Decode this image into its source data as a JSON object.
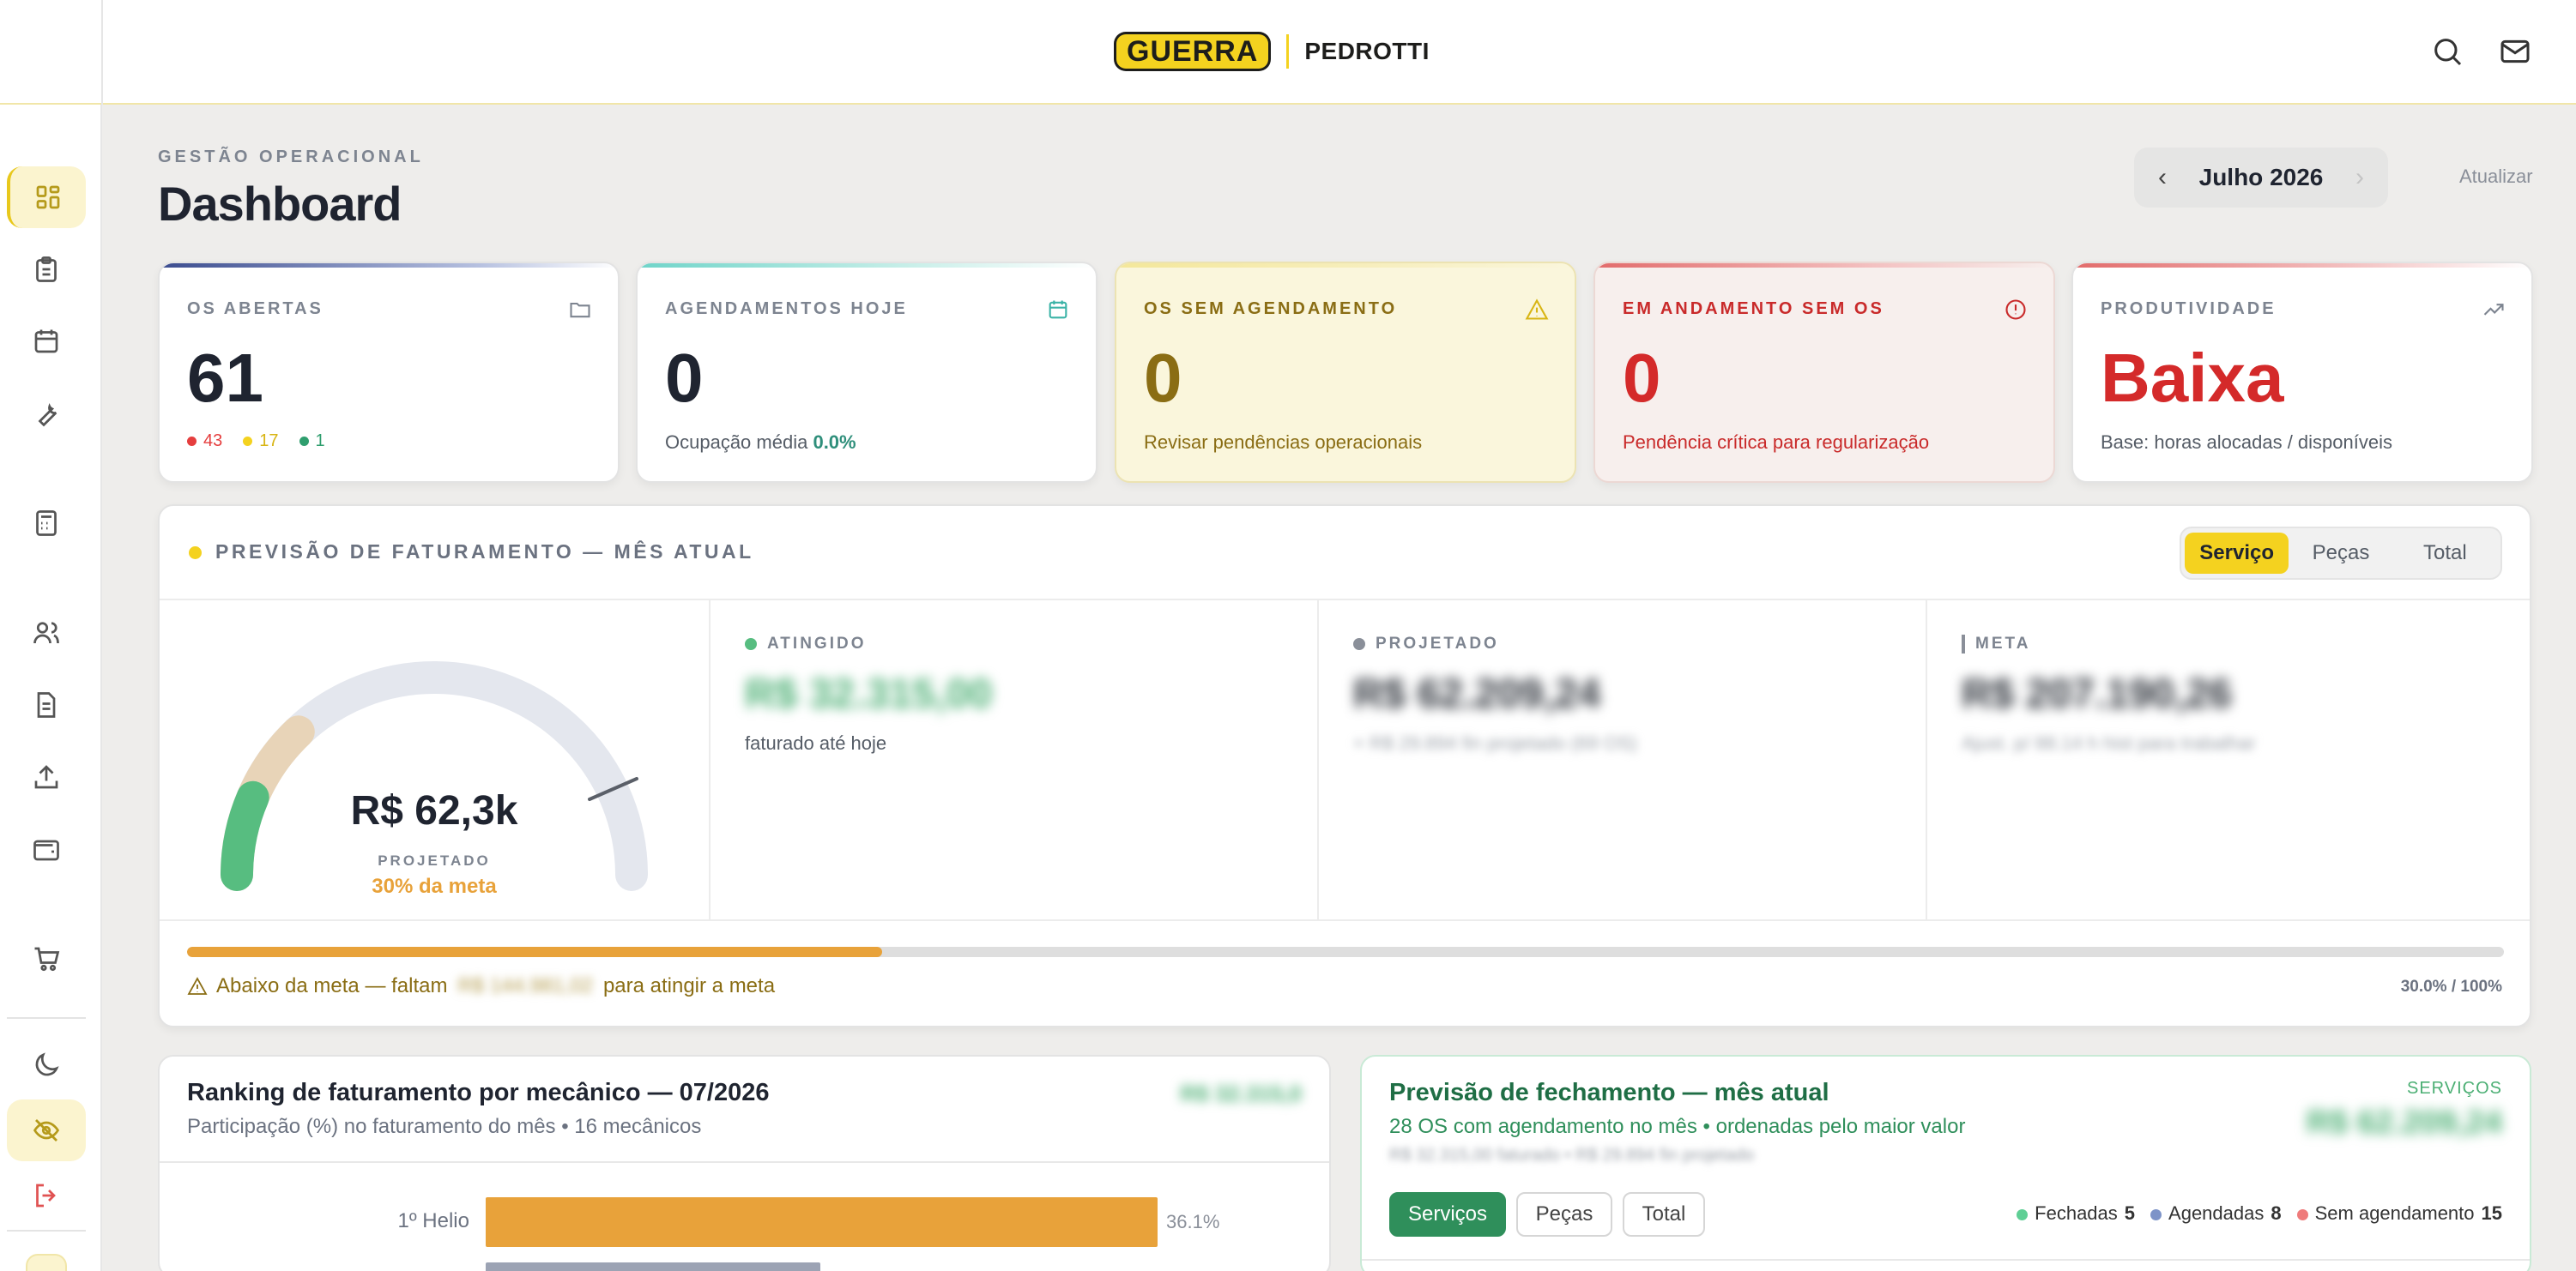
{
  "brand": {
    "left": "GUERRA",
    "right": "PEDROTTI"
  },
  "header": {
    "eyebrow": "GESTÃO OPERACIONAL",
    "title": "Dashboard",
    "month": "Julho 2026",
    "refresh": "Atualizar"
  },
  "cards": [
    {
      "title": "OS ABERTAS",
      "value": "61",
      "icon": "folder-icon",
      "dots": [
        {
          "value": "43",
          "color": "#e53e3e"
        },
        {
          "value": "17",
          "color": "#f4d21f"
        },
        {
          "value": "1",
          "color": "#2f9e6e"
        }
      ]
    },
    {
      "title": "AGENDAMENTOS HOJE",
      "value": "0",
      "icon": "calendar-icon",
      "sub_prefix": "Ocupação média",
      "sub_value": "0.0%"
    },
    {
      "title": "OS SEM AGENDAMENTO",
      "value": "0",
      "icon": "warning-icon",
      "sub": "Revisar pendências operacionais"
    },
    {
      "title": "EM ANDAMENTO SEM OS",
      "value": "0",
      "icon": "alert-circle-icon",
      "sub": "Pendência crítica para regularização"
    },
    {
      "title": "PRODUTIVIDADE",
      "value": "Baixa",
      "icon": "trend-icon",
      "sub": "Base: horas alocadas / disponíveis"
    }
  ],
  "forecast": {
    "title": "PREVISÃO DE FATURAMENTO — MÊS ATUAL",
    "tabs": [
      "Serviço",
      "Peças",
      "Total"
    ],
    "active_tab": "Serviço",
    "gauge": {
      "value": "R$ 62,3k",
      "label": "PROJETADO",
      "pct": "30% da meta",
      "fraction": 0.3
    },
    "achieved": {
      "label": "ATINGIDO",
      "value": "R$ 32.315,00",
      "sub": "faturado até hoje"
    },
    "projected": {
      "label": "PROJETADO",
      "value": "R$ 62.209,24",
      "sub": "+ R$ 29.894 fin projetado (69 OS)"
    },
    "goal": {
      "label": "META",
      "value": "R$ 207.190,26",
      "sub": "Ajust. p/ 88.14 h hist para trabalhar"
    },
    "progress": {
      "fraction": 0.3,
      "text": "30.0% / 100%"
    },
    "warning": {
      "prefix": "Abaixo da meta — faltam",
      "amount": "R$ 144.981,02",
      "suffix": "para atingir a meta"
    }
  },
  "ranking": {
    "title": "Ranking de faturamento por mecânico — 07/2026",
    "subtitle": "Participação (%) no faturamento do mês • 16 mecânicos",
    "total": "R$ 32.315,0",
    "rows": [
      {
        "label": "1º Helio",
        "pct": "36.1%",
        "value": 36.1
      }
    ]
  },
  "closing": {
    "title": "Previsão de fechamento — mês atual",
    "subtitle": "28 OS com agendamento no mês • ordenadas pelo maior valor",
    "subtitle2": "R$ 32.315,00 faturado • R$ 29.894 fin projetado",
    "badge": "SERVIÇOS",
    "value": "R$ 62.209,24",
    "tabs": [
      "Serviços",
      "Peças",
      "Total"
    ],
    "legend": [
      {
        "label": "Fechadas",
        "count": "5",
        "color": "#5fcf95"
      },
      {
        "label": "Agendadas",
        "count": "8",
        "color": "#7d93c8"
      },
      {
        "label": "Sem agendamento",
        "count": "15",
        "color": "#ef7b7b"
      }
    ]
  }
}
